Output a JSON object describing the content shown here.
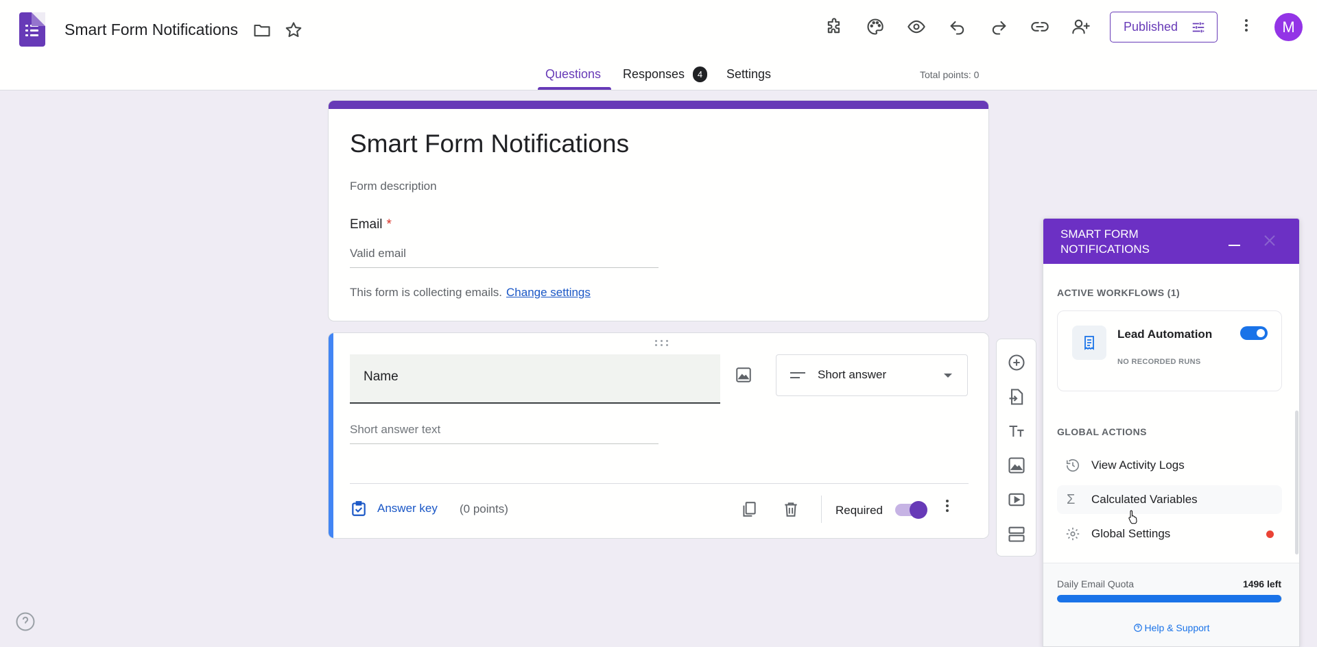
{
  "header": {
    "app_title": "Smart Form Notifications",
    "publish_label": "Published",
    "avatar_initial": "M"
  },
  "tabs": [
    {
      "label": "Questions",
      "active": true
    },
    {
      "label": "Responses",
      "badge": "4"
    },
    {
      "label": "Settings"
    }
  ],
  "total_points": "Total points: 0",
  "form": {
    "title": "Smart Form Notifications",
    "description_placeholder": "Form description",
    "email_label": "Email",
    "email_required_mark": "*",
    "email_placeholder": "Valid email",
    "collect_note": "This form is collecting emails.",
    "change_settings_link": "Change settings"
  },
  "question": {
    "title": "Name",
    "type": "Short answer",
    "answer_placeholder": "Short answer text",
    "answer_key_label": "Answer key",
    "points_label": "(0 points)",
    "required_label": "Required",
    "required": true
  },
  "panel": {
    "title": "SMART FORM NOTIFICATIONS",
    "active_workflows_heading": "ACTIVE WORKFLOWS (1)",
    "workflow": {
      "name": "Lead Automation",
      "status": "NO RECORDED RUNS",
      "enabled": true
    },
    "global_actions_heading": "GLOBAL ACTIONS",
    "actions": [
      {
        "label": "View Activity Logs",
        "icon": "history-icon"
      },
      {
        "label": "Calculated Variables",
        "icon": "sigma-icon"
      },
      {
        "label": "Global Settings",
        "icon": "gear-icon",
        "alert": true
      }
    ],
    "quota_label": "Daily Email Quota",
    "quota_value": "1496 left",
    "quota_fraction": 0.997,
    "help_link": "Help & Support"
  },
  "colors": {
    "brand": "#673ab7",
    "panel_header": "#6c30c4",
    "link": "#1a57c6",
    "accent_blue": "#1a73e8",
    "alert": "#ea4335"
  }
}
